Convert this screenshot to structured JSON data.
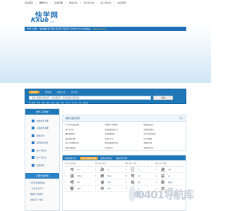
{
  "topnav": [
    "设为首页",
    "|",
    "推荐分享",
    "|",
    "汉语词典",
    "|",
    "成语大全",
    "|",
    "近义词大全",
    "|",
    "反义词大全",
    "|",
    "古诗词文"
  ],
  "logo": {
    "cn": "快学网",
    "en": "Kxue",
    "com": ".com"
  },
  "userbar": {
    "text": "[登录] [注册]",
    "links": "最新收藏 热门词条 拼音查字 部首查字 组词大全 造句 成语接龙",
    "highlight": "www.kxue.com"
  },
  "search": {
    "tabs": [
      "查汉字",
      "查词语",
      "成语大全",
      "近义词"
    ],
    "placeholder": "请输入需要查询的汉字、拼音或部首，按查询即可获取结果",
    "button": "查询",
    "hot": "热门搜索：拼音 · 部首 · 笔画 · 组词 · 成语 · 造句 · 近义词 · 反义词 · 古诗 · 歇后语"
  },
  "sidebar": {
    "header": "快学工具导航",
    "items": [
      "在线新华字典",
      "汉语拼音词典",
      "成语大全",
      "组词造句大全",
      "近义词大全",
      "反义词大全",
      "在线组词"
    ],
    "header2": "字典分类查询",
    "sub": [
      "汉字部首笔画查询",
      "一字多音多义字",
      "繁体字与简体字",
      "常用汉字一览表"
    ]
  },
  "panel": {
    "title": "最新汉语文章页",
    "more": "更多",
    "links": [
      "严与北京成语词典",
      "在线新华字典查询",
      "精选成语大全",
      "近义词大全",
      "常用成语接龙大全",
      "在线组词造句",
      "最新笔画查字",
      "成语故事精选",
      "汉字拼音对照表",
      "成语出处详解",
      "常用反义词",
      "近义词辨析",
      "汉字书写笔顺大全",
      "现代汉语规范字典",
      "部首检字法",
      "成语分类查询",
      "古诗文名句",
      "常用谚语大全"
    ]
  },
  "dict": {
    "tabs": [
      "按笔画查字典：",
      "单汉字拼音查字典",
      "按部首查字典：",
      "按拼音查字典"
    ],
    "columns": [
      {
        "hdr": "序号  汉字  拼音",
        "rows": [
          {
            "n": "1",
            "c": "帀",
            "p": "zā"
          },
          {
            "n": "2",
            "c": "疆",
            "p": "jiāng"
          },
          {
            "n": "3",
            "c": "唔",
            "p": "wú"
          },
          {
            "n": "4",
            "c": "鞭",
            "p": "biān"
          }
        ]
      },
      {
        "hdr": "序号  汉字  拼音",
        "rows": [
          {
            "n": "5",
            "c": "辟",
            "p": "pì"
          },
          {
            "n": "6",
            "c": "腾",
            "p": "téng"
          },
          {
            "n": "7",
            "c": "诸",
            "p": "zhū"
          },
          {
            "n": "8",
            "c": "辫",
            "p": "biàn"
          }
        ]
      },
      {
        "hdr": "序号  汉字  拼音",
        "rows": [
          {
            "n": "9",
            "c": "巳",
            "p": "sì"
          },
          {
            "n": "10",
            "c": "鹜",
            "p": "wù"
          },
          {
            "n": "11",
            "c": "褐",
            "p": "hè"
          },
          {
            "n": "12",
            "c": "龃",
            "p": "jǔ"
          }
        ]
      },
      {
        "hdr": "序号  汉字  拼音",
        "rows": [
          {
            "n": "13",
            "c": "潍",
            "p": "wéi"
          },
          {
            "n": "14",
            "c": "揄",
            "p": "yú"
          },
          {
            "n": "15",
            "c": "赓",
            "p": "gēng"
          },
          {
            "n": "16",
            "c": "邛",
            "p": "qióng"
          }
        ]
      }
    ]
  },
  "watermark": "0401导航库"
}
